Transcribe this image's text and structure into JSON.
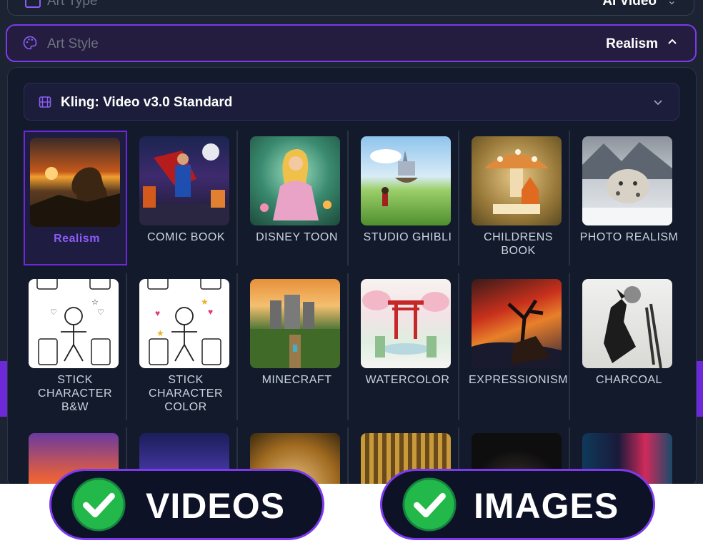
{
  "art_type": {
    "label": "Art Type",
    "value": "AI Video"
  },
  "art_style": {
    "label": "Art Style",
    "value": "Realism"
  },
  "model_select": {
    "value": "Kling: Video v3.0 Standard"
  },
  "styles": [
    {
      "name": "Realism",
      "selected": true
    },
    {
      "name": "COMIC BOOK"
    },
    {
      "name": "DISNEY TOON"
    },
    {
      "name": "STUDIO GHIBLI"
    },
    {
      "name": "CHILDRENS BOOK"
    },
    {
      "name": "PHOTO REALISM"
    },
    {
      "name": "STICK CHARACTER B&W"
    },
    {
      "name": "STICK CHARACTER COLOR"
    },
    {
      "name": "MINECRAFT"
    },
    {
      "name": "WATERCOLOR"
    },
    {
      "name": "EXPRESSIONISM"
    },
    {
      "name": "CHARCOAL"
    }
  ],
  "badges": {
    "videos": "VIDEOS",
    "images": "IMAGES"
  },
  "icons": {
    "art_type": "film-icon",
    "art_style": "palette-icon",
    "model": "film-icon",
    "check": "check-icon"
  },
  "colors": {
    "accent": "#7c3aed",
    "background": "#121a2b",
    "selected_text": "#8b5cf6"
  }
}
